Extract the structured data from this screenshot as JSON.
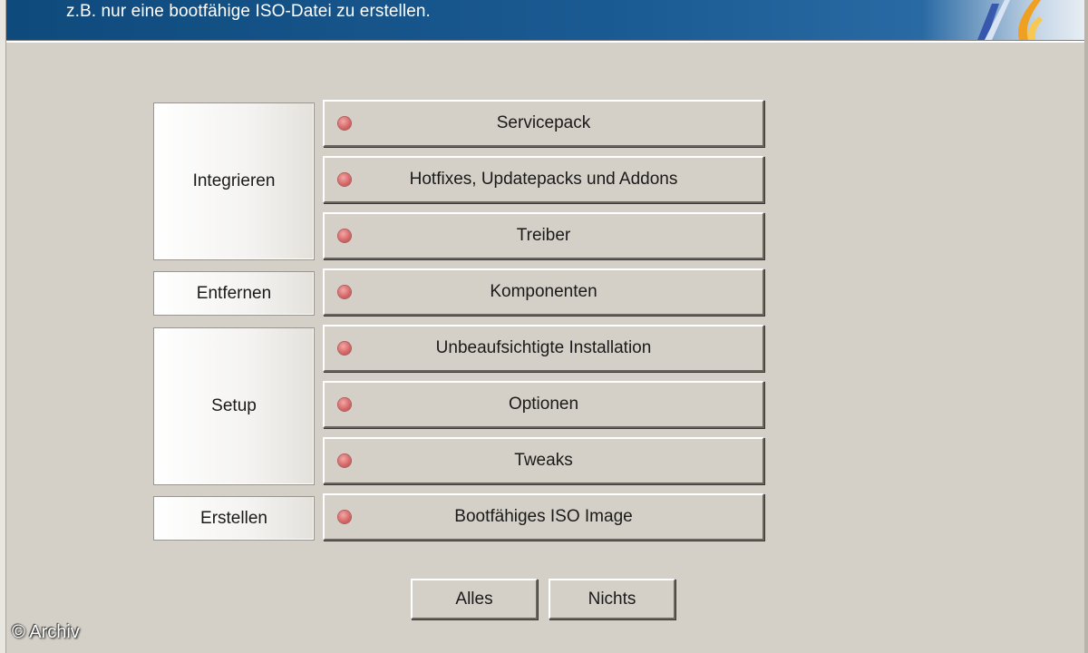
{
  "header": {
    "banner_text": "z.B. nur eine bootfähige ISO-Datei zu erstellen."
  },
  "groups": [
    {
      "label": "Integrieren"
    },
    {
      "label": "Entfernen"
    },
    {
      "label": "Setup"
    },
    {
      "label": "Erstellen"
    }
  ],
  "options": [
    {
      "label": "Servicepack"
    },
    {
      "label": "Hotfixes, Updatepacks und Addons"
    },
    {
      "label": "Treiber"
    },
    {
      "label": "Komponenten"
    },
    {
      "label": "Unbeaufsichtigte Installation"
    },
    {
      "label": "Optionen"
    },
    {
      "label": "Tweaks"
    },
    {
      "label": "Bootfähiges ISO Image"
    }
  ],
  "footer": {
    "all_label": "Alles",
    "none_label": "Nichts"
  },
  "watermark": "© Archiv",
  "colors": {
    "banner": "#1a5a92",
    "background": "#d4d0c8",
    "indicator": "#d86a6a"
  }
}
